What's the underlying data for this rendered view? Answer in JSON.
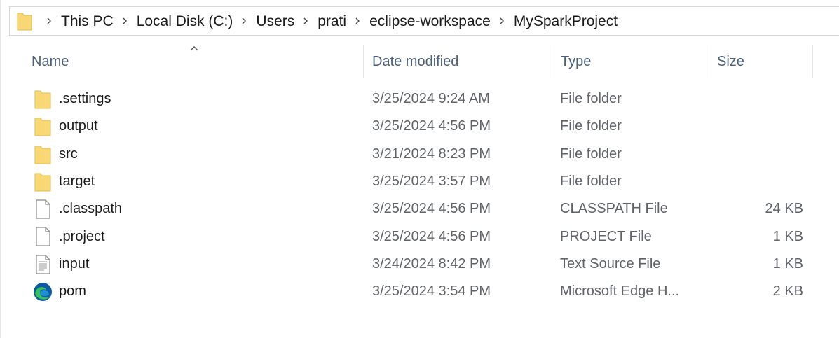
{
  "breadcrumb": {
    "items": [
      "This PC",
      "Local Disk (C:)",
      "Users",
      "prati",
      "eclipse-workspace",
      "MySparkProject"
    ]
  },
  "columns": {
    "name": "Name",
    "date": "Date modified",
    "type": "Type",
    "size": "Size"
  },
  "files": [
    {
      "name": ".settings",
      "date": "3/25/2024 9:24 AM",
      "type": "File folder",
      "size": "",
      "icon": "folder-icon"
    },
    {
      "name": "output",
      "date": "3/25/2024 4:56 PM",
      "type": "File folder",
      "size": "",
      "icon": "folder-icon"
    },
    {
      "name": "src",
      "date": "3/21/2024 8:23 PM",
      "type": "File folder",
      "size": "",
      "icon": "folder-icon"
    },
    {
      "name": "target",
      "date": "3/25/2024 3:57 PM",
      "type": "File folder",
      "size": "",
      "icon": "folder-icon"
    },
    {
      "name": ".classpath",
      "date": "3/25/2024 4:56 PM",
      "type": "CLASSPATH File",
      "size": "24 KB",
      "icon": "file-icon"
    },
    {
      "name": ".project",
      "date": "3/25/2024 4:56 PM",
      "type": "PROJECT File",
      "size": "1 KB",
      "icon": "file-icon"
    },
    {
      "name": "input",
      "date": "3/24/2024 8:42 PM",
      "type": "Text Source File",
      "size": "1 KB",
      "icon": "text-file-icon"
    },
    {
      "name": "pom",
      "date": "3/25/2024 3:54 PM",
      "type": "Microsoft Edge H...",
      "size": "2 KB",
      "icon": "edge-icon"
    }
  ],
  "colors": {
    "folder": "#f8d775",
    "header_text": "#4c607a",
    "edge_blue": "#0c59a4",
    "edge_green": "#36c25b"
  }
}
